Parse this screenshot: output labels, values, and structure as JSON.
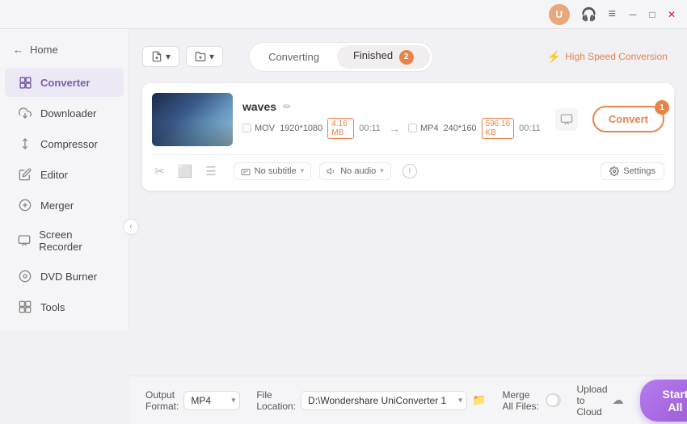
{
  "titlebar": {
    "avatar_label": "U",
    "menu_icon": "≡",
    "minimize": "─",
    "maximize": "□",
    "close": "✕"
  },
  "sidebar": {
    "home_label": "Home",
    "items": [
      {
        "id": "converter",
        "label": "Converter",
        "icon": "⚙",
        "active": true
      },
      {
        "id": "downloader",
        "label": "Downloader",
        "icon": "⬇"
      },
      {
        "id": "compressor",
        "label": "Compressor",
        "icon": "🗜"
      },
      {
        "id": "editor",
        "label": "Editor",
        "icon": "✏"
      },
      {
        "id": "merger",
        "label": "Merger",
        "icon": "⊕"
      },
      {
        "id": "screen-recorder",
        "label": "Screen Recorder",
        "icon": "⬛"
      },
      {
        "id": "dvd-burner",
        "label": "DVD Burner",
        "icon": "💿"
      },
      {
        "id": "tools",
        "label": "Tools",
        "icon": "🔧"
      }
    ]
  },
  "tabs": {
    "converting_label": "Converting",
    "finished_label": "Finished",
    "finished_badge": "2",
    "active": "finished"
  },
  "high_speed": {
    "label": "High Speed Conversion"
  },
  "add_buttons": {
    "add_file_label": "＋",
    "add_folder_label": "＋"
  },
  "file": {
    "name": "waves",
    "source_format": "MOV",
    "source_resolution": "1920*1080",
    "source_size": "4.16 MB",
    "source_duration": "00:11",
    "target_format": "MP4",
    "target_resolution": "240*160",
    "target_size": "596.16 KB",
    "target_duration": "00:11",
    "subtitle_label": "No subtitle",
    "audio_label": "No audio",
    "settings_label": "Settings",
    "convert_btn_label": "Convert",
    "convert_btn_badge": "1"
  },
  "bottom": {
    "output_format_label": "Output Format:",
    "output_format_value": "MP4",
    "file_location_label": "File Location:",
    "file_location_path": "D:\\Wondershare UniConverter 1",
    "merge_files_label": "Merge All Files:",
    "upload_cloud_label": "Upload to Cloud",
    "start_all_label": "Start All"
  }
}
